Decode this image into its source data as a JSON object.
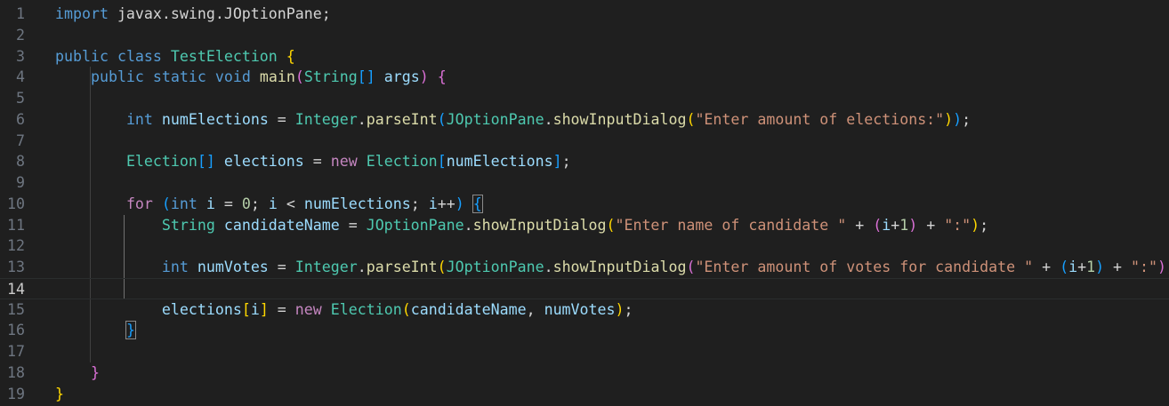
{
  "editor": {
    "active_line": 14,
    "lines": [
      [
        {
          "t": "import",
          "c": "kw"
        },
        {
          "t": " javax.swing.JOptionPane;",
          "c": "pl"
        }
      ],
      [],
      [
        {
          "t": "public",
          "c": "kw"
        },
        {
          "t": " ",
          "c": "pl"
        },
        {
          "t": "class",
          "c": "kw"
        },
        {
          "t": " ",
          "c": "pl"
        },
        {
          "t": "TestElection",
          "c": "ty"
        },
        {
          "t": " ",
          "c": "pl"
        },
        {
          "t": "{",
          "c": "b1"
        }
      ],
      [
        {
          "t": "    ",
          "c": "pl"
        },
        {
          "t": "public",
          "c": "kw"
        },
        {
          "t": " ",
          "c": "pl"
        },
        {
          "t": "static",
          "c": "kw"
        },
        {
          "t": " ",
          "c": "pl"
        },
        {
          "t": "void",
          "c": "kw"
        },
        {
          "t": " ",
          "c": "pl"
        },
        {
          "t": "main",
          "c": "fn"
        },
        {
          "t": "(",
          "c": "b2"
        },
        {
          "t": "String",
          "c": "ty"
        },
        {
          "t": "[]",
          "c": "b3"
        },
        {
          "t": " ",
          "c": "pl"
        },
        {
          "t": "args",
          "c": "var"
        },
        {
          "t": ")",
          "c": "b2"
        },
        {
          "t": " ",
          "c": "pl"
        },
        {
          "t": "{",
          "c": "b2"
        }
      ],
      [],
      [
        {
          "t": "        ",
          "c": "pl"
        },
        {
          "t": "int",
          "c": "kw"
        },
        {
          "t": " ",
          "c": "pl"
        },
        {
          "t": "numElections",
          "c": "var"
        },
        {
          "t": " = ",
          "c": "op"
        },
        {
          "t": "Integer",
          "c": "ty"
        },
        {
          "t": ".",
          "c": "pl"
        },
        {
          "t": "parseInt",
          "c": "fn"
        },
        {
          "t": "(",
          "c": "b3"
        },
        {
          "t": "JOptionPane",
          "c": "ty"
        },
        {
          "t": ".",
          "c": "pl"
        },
        {
          "t": "showInputDialog",
          "c": "fn"
        },
        {
          "t": "(",
          "c": "b1"
        },
        {
          "t": "\"Enter amount of elections:\"",
          "c": "str"
        },
        {
          "t": ")",
          "c": "b1"
        },
        {
          "t": ")",
          "c": "b3"
        },
        {
          "t": ";",
          "c": "pl"
        }
      ],
      [],
      [
        {
          "t": "        ",
          "c": "pl"
        },
        {
          "t": "Election",
          "c": "ty"
        },
        {
          "t": "[]",
          "c": "b3"
        },
        {
          "t": " ",
          "c": "pl"
        },
        {
          "t": "elections",
          "c": "var"
        },
        {
          "t": " = ",
          "c": "op"
        },
        {
          "t": "new",
          "c": "ctl"
        },
        {
          "t": " ",
          "c": "pl"
        },
        {
          "t": "Election",
          "c": "ty"
        },
        {
          "t": "[",
          "c": "b3"
        },
        {
          "t": "numElections",
          "c": "var"
        },
        {
          "t": "]",
          "c": "b3"
        },
        {
          "t": ";",
          "c": "pl"
        }
      ],
      [],
      [
        {
          "t": "        ",
          "c": "pl"
        },
        {
          "t": "for",
          "c": "ctl"
        },
        {
          "t": " ",
          "c": "pl"
        },
        {
          "t": "(",
          "c": "b3"
        },
        {
          "t": "int",
          "c": "kw"
        },
        {
          "t": " ",
          "c": "pl"
        },
        {
          "t": "i",
          "c": "var"
        },
        {
          "t": " = ",
          "c": "op"
        },
        {
          "t": "0",
          "c": "num"
        },
        {
          "t": "; ",
          "c": "pl"
        },
        {
          "t": "i",
          "c": "var"
        },
        {
          "t": " < ",
          "c": "op"
        },
        {
          "t": "numElections",
          "c": "var"
        },
        {
          "t": "; ",
          "c": "pl"
        },
        {
          "t": "i",
          "c": "var"
        },
        {
          "t": "++",
          "c": "op"
        },
        {
          "t": ")",
          "c": "b3"
        },
        {
          "t": " ",
          "c": "pl"
        },
        {
          "t": "{",
          "c": "b3",
          "box": true
        }
      ],
      [
        {
          "t": "            ",
          "c": "pl"
        },
        {
          "t": "String",
          "c": "ty"
        },
        {
          "t": " ",
          "c": "pl"
        },
        {
          "t": "candidateName",
          "c": "var"
        },
        {
          "t": " = ",
          "c": "op"
        },
        {
          "t": "JOptionPane",
          "c": "ty"
        },
        {
          "t": ".",
          "c": "pl"
        },
        {
          "t": "showInputDialog",
          "c": "fn"
        },
        {
          "t": "(",
          "c": "b1"
        },
        {
          "t": "\"Enter name of candidate \"",
          "c": "str"
        },
        {
          "t": " + ",
          "c": "op"
        },
        {
          "t": "(",
          "c": "b2"
        },
        {
          "t": "i",
          "c": "var"
        },
        {
          "t": "+",
          "c": "op"
        },
        {
          "t": "1",
          "c": "num"
        },
        {
          "t": ")",
          "c": "b2"
        },
        {
          "t": " + ",
          "c": "op"
        },
        {
          "t": "\":\"",
          "c": "str"
        },
        {
          "t": ")",
          "c": "b1"
        },
        {
          "t": ";",
          "c": "pl"
        }
      ],
      [],
      [
        {
          "t": "            ",
          "c": "pl"
        },
        {
          "t": "int",
          "c": "kw"
        },
        {
          "t": " ",
          "c": "pl"
        },
        {
          "t": "numVotes",
          "c": "var"
        },
        {
          "t": " = ",
          "c": "op"
        },
        {
          "t": "Integer",
          "c": "ty"
        },
        {
          "t": ".",
          "c": "pl"
        },
        {
          "t": "parseInt",
          "c": "fn"
        },
        {
          "t": "(",
          "c": "b1"
        },
        {
          "t": "JOptionPane",
          "c": "ty"
        },
        {
          "t": ".",
          "c": "pl"
        },
        {
          "t": "showInputDialog",
          "c": "fn"
        },
        {
          "t": "(",
          "c": "b2"
        },
        {
          "t": "\"Enter amount of votes for candidate \"",
          "c": "str"
        },
        {
          "t": " + ",
          "c": "op"
        },
        {
          "t": "(",
          "c": "b3"
        },
        {
          "t": "i",
          "c": "var"
        },
        {
          "t": "+",
          "c": "op"
        },
        {
          "t": "1",
          "c": "num"
        },
        {
          "t": ")",
          "c": "b3"
        },
        {
          "t": " + ",
          "c": "op"
        },
        {
          "t": "\":\"",
          "c": "str"
        },
        {
          "t": ")",
          "c": "b2"
        },
        {
          "t": ")",
          "c": "b1"
        },
        {
          "t": ";",
          "c": "pl"
        }
      ],
      [],
      [
        {
          "t": "            ",
          "c": "pl"
        },
        {
          "t": "elections",
          "c": "var"
        },
        {
          "t": "[",
          "c": "b1"
        },
        {
          "t": "i",
          "c": "var"
        },
        {
          "t": "]",
          "c": "b1"
        },
        {
          "t": " = ",
          "c": "op"
        },
        {
          "t": "new",
          "c": "ctl"
        },
        {
          "t": " ",
          "c": "pl"
        },
        {
          "t": "Election",
          "c": "ty"
        },
        {
          "t": "(",
          "c": "b1"
        },
        {
          "t": "candidateName",
          "c": "var"
        },
        {
          "t": ", ",
          "c": "pl"
        },
        {
          "t": "numVotes",
          "c": "var"
        },
        {
          "t": ")",
          "c": "b1"
        },
        {
          "t": ";",
          "c": "pl"
        }
      ],
      [
        {
          "t": "        ",
          "c": "pl"
        },
        {
          "t": "}",
          "c": "b3",
          "box": true
        }
      ],
      [],
      [
        {
          "t": "    ",
          "c": "pl"
        },
        {
          "t": "}",
          "c": "b2"
        }
      ],
      [
        {
          "t": "}",
          "c": "b1"
        }
      ]
    ]
  }
}
